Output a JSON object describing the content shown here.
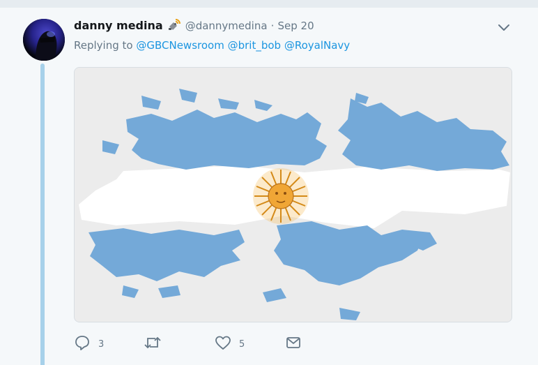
{
  "tweet": {
    "author_name": "danny medina",
    "handle": "@dannymedina",
    "separator": "·",
    "date": "Sep 20",
    "replying_prefix": "Replying to",
    "mentions": [
      "@GBCNewsroom",
      "@brit_bob",
      "@RoyalNavy"
    ],
    "badge_icon": "satellite-icon",
    "menu_icon": "chevron-down-icon"
  },
  "actions": {
    "reply_count": "3",
    "retweet_count": "",
    "like_count": "5"
  },
  "colors": {
    "accent": "#1b95e0",
    "thread_line": "#a7d1ea",
    "muted_text": "#657786",
    "flag_blue": "#74a9d8"
  }
}
